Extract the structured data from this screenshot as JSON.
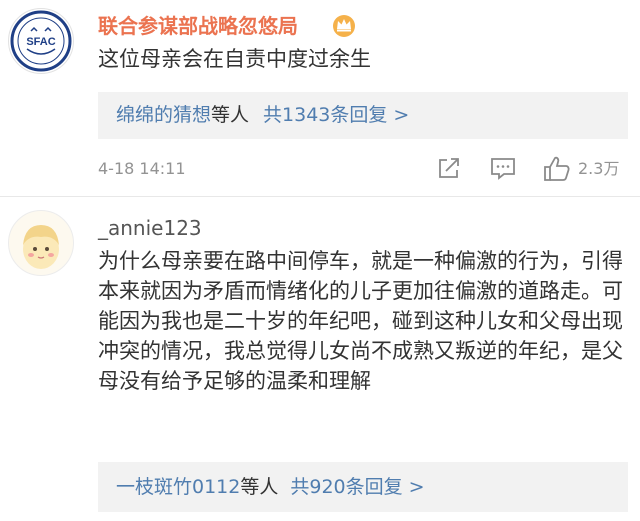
{
  "comment1": {
    "author": "联合参谋部战略忽悠局",
    "avatar_text": "SFAC",
    "text": "这位母亲会在自责中度过余生",
    "reply_names": "绵绵的猜想",
    "reply_mid": "等人",
    "reply_count": "共1343条回复 >",
    "timestamp": "4-18 14:11",
    "like_count": "2.3万"
  },
  "comment2": {
    "author": "_annie123",
    "text": "为什么母亲要在路中间停车，就是一种偏激的行为，引得本来就因为矛盾而情绪化的儿子更加往偏激的道路走。可能因为我也是二十岁的年纪吧，碰到这种儿女和父母出现冲突的情况，我总觉得儿女尚不成熟又叛逆的年纪，是父母没有给予足够的温柔和理解",
    "reply_names": "一枝斑竹0112",
    "reply_mid": "等人",
    "reply_count": "共920条回复 >"
  },
  "colors": {
    "author_vip": "#eb7350",
    "link_blue": "#507daf",
    "meta_gray": "#939393",
    "reply_bg": "#f2f2f2"
  },
  "icons": [
    "crown-badge-icon",
    "share-icon",
    "comment-icon",
    "thumbs-up-icon"
  ]
}
